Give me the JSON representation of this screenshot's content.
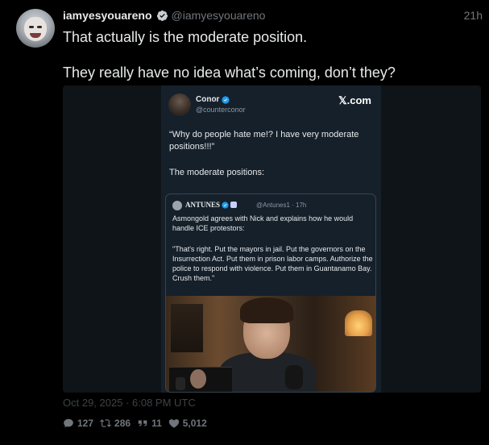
{
  "post": {
    "display_name": "iamyesyouareno",
    "handle": "@iamyesyouareno",
    "time_ago": "21h",
    "line1": "That actually is the moderate position.",
    "line2": "They really have no idea what’s coming, don’t they?",
    "date": "Oct 29, 2025 · 6:08 PM UTC",
    "accent_color": "#1d9bf0"
  },
  "screenshot_card": {
    "author_name": "Conor",
    "author_handle": "@counterconor",
    "brand": "𝕏.com",
    "body_line1": "“Why do people hate me!? I have very moderate positions!!!”",
    "body_line2": "The moderate positions:",
    "quote": {
      "author_name": "ANTUNES",
      "handle_time": "@Antunes1 · 17h",
      "text1": "Asmongold agrees with Nick and explains how he would handle ICE protestors:",
      "text2": "\"That's right. Put the mayors in jail. Put the governors on the Insurrection Act. Put them in prison labor camps. Authorize the police to respond with violence. Put them in Guantanamo Bay. Crush them.\""
    }
  },
  "stats": {
    "replies": "127",
    "retweets": "286",
    "quotes": "11",
    "likes": "5,012"
  }
}
